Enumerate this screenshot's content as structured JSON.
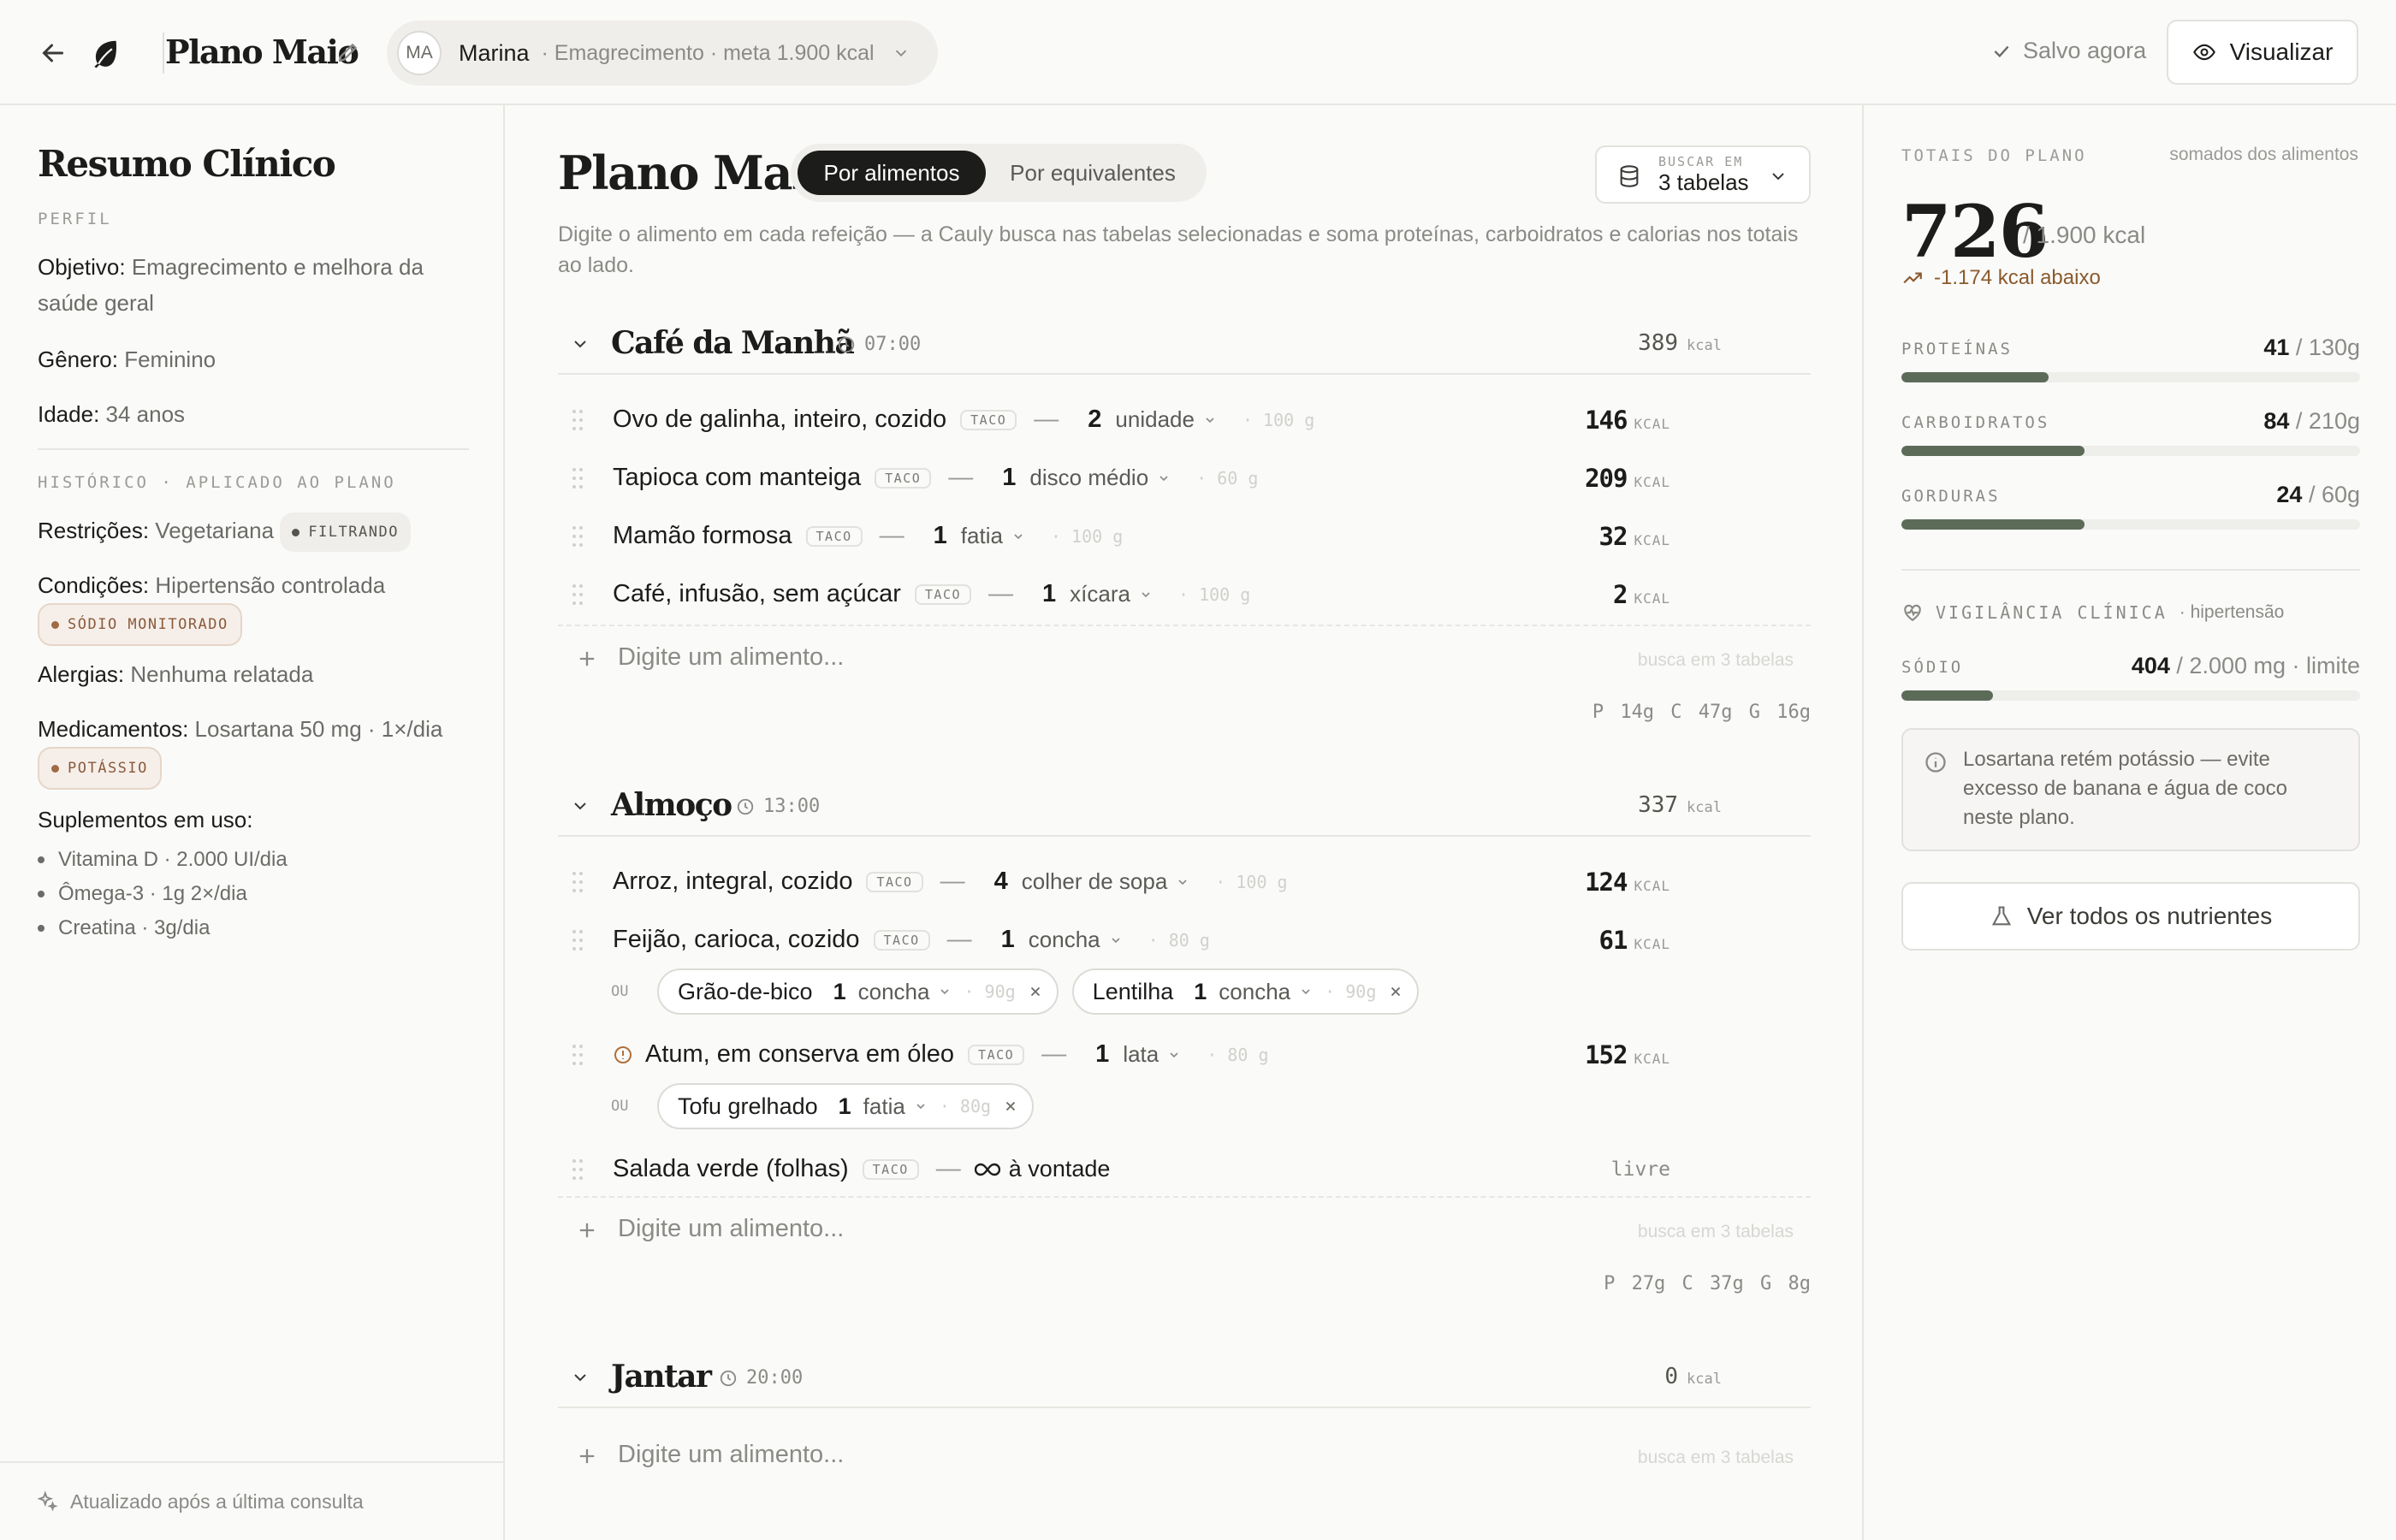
{
  "topbar": {
    "plan_name": "Plano Maio",
    "patient": {
      "initials": "MA",
      "name": "Marina",
      "goal": "· Emagrecimento · meta 1.900 kcal"
    },
    "save_status": "Salvo agora",
    "preview_label": "Visualizar"
  },
  "left": {
    "title": "Resumo Clínico",
    "profile_label": "PERFIL",
    "objective_label": "Objetivo:",
    "objective": "Emagrecimento e melhora da saúde geral",
    "gender_label": "Gênero:",
    "gender": "Feminino",
    "age_label": "Idade:",
    "age": "34 anos",
    "history_label": "HISTÓRICO · APLICADO AO PLANO",
    "restrictions_label": "Restrições:",
    "restrictions": "Vegetariana",
    "restrictions_chip": "FILTRANDO",
    "conditions_label": "Condições:",
    "conditions": "Hipertensão controlada",
    "conditions_chip": "SÓDIO MONITORADO",
    "allergies_label": "Alergias:",
    "allergies": "Nenhuma relatada",
    "meds_label": "Medicamentos:",
    "meds": "Losartana 50 mg · 1×/dia",
    "meds_chip": "POTÁSSIO",
    "supplements_label": "Suplementos em uso:",
    "supplements": [
      "Vitamina D · 2.000 UI/dia",
      "Ômega-3 · 1g 2×/dia",
      "Creatina · 3g/dia"
    ],
    "footer": "Atualizado após a última consulta"
  },
  "main": {
    "title": "Plano Maio",
    "tabs": [
      {
        "label": "Por alimentos"
      },
      {
        "label": "Por equivalentes"
      }
    ],
    "search": {
      "label": "BUSCAR EM",
      "value": "3 tabelas"
    },
    "description": "Digite o alimento em cada refeição — a Cauly busca nas tabelas selecionadas e soma proteínas, carboidratos e calorias nos totais ao lado.",
    "add_placeholder": "Digite um alimento...",
    "add_hint": "busca em 3 tabelas",
    "kcal_unit": "kcal",
    "kcal_unit_caps": "KCAL",
    "or_label": "OU",
    "source_tag": "TACO",
    "dash": "—",
    "meals": [
      {
        "name": "Café da Manhã",
        "time": "07:00",
        "kcal": "389",
        "foods": [
          {
            "name": "Ovo de galinha, inteiro, cozido",
            "qty": "2",
            "unit": "unidade",
            "grams": "100 g",
            "kcal": "146"
          },
          {
            "name": "Tapioca com manteiga",
            "qty": "1",
            "unit": "disco médio",
            "grams": "60 g",
            "kcal": "209"
          },
          {
            "name": "Mamão formosa",
            "qty": "1",
            "unit": "fatia",
            "grams": "100 g",
            "kcal": "32"
          },
          {
            "name": "Café, infusão, sem açúcar",
            "qty": "1",
            "unit": "xícara",
            "grams": "100 g",
            "kcal": "2"
          }
        ],
        "macros": "P 14g  C 47g  G 16g"
      },
      {
        "name": "Almoço",
        "time": "13:00",
        "kcal": "337",
        "foods": [
          {
            "name": "Arroz, integral, cozido",
            "qty": "4",
            "unit": "colher de sopa",
            "grams": "100 g",
            "kcal": "124"
          },
          {
            "name": "Feijão, carioca, cozido",
            "qty": "1",
            "unit": "concha",
            "grams": "80 g",
            "kcal": "61",
            "alts": [
              {
                "name": "Grão-de-bico",
                "qty": "1",
                "unit": "concha",
                "grams": "90g"
              },
              {
                "name": "Lentilha",
                "qty": "1",
                "unit": "concha",
                "grams": "90g"
              }
            ]
          },
          {
            "name": "Atum, em conserva em óleo",
            "qty": "1",
            "unit": "lata",
            "grams": "80 g",
            "kcal": "152",
            "alts": [
              {
                "name": "Tofu grelhado",
                "qty": "1",
                "unit": "fatia",
                "grams": "80g"
              }
            ]
          },
          {
            "name": "Salada verde (folhas)",
            "amount": "à vontade",
            "free": "livre"
          }
        ],
        "macros": "P 27g  C 37g  G 8g"
      },
      {
        "name": "Jantar",
        "time": "20:00",
        "kcal": "0"
      }
    ]
  },
  "right": {
    "totals_label": "TOTAIS DO PLANO",
    "totals_sub": "somados dos alimentos",
    "total_kcal": "726",
    "target": "/ 1.900 kcal",
    "delta": "-1.174 kcal abaixo",
    "macros": [
      {
        "label": "PROTEÍNAS",
        "value": "41",
        "target": "/ 130g",
        "progress": 0.32
      },
      {
        "label": "CARBOIDRATOS",
        "value": "84",
        "target": "/ 210g",
        "progress": 0.4
      },
      {
        "label": "GORDURAS",
        "value": "24",
        "target": "/ 60g",
        "progress": 0.4
      }
    ],
    "vigilance_label": "VIGILÂNCIA CLÍNICA",
    "vigilance_sub": "· hipertensão",
    "sodium": {
      "label": "SÓDIO",
      "value": "404",
      "target": "/ 2.000 mg · limite",
      "progress": 0.2
    },
    "note": "Losartana retém potássio — evite excesso de banana e água de coco neste plano.",
    "all_nutrients_label": "Ver todos os nutrientes"
  }
}
